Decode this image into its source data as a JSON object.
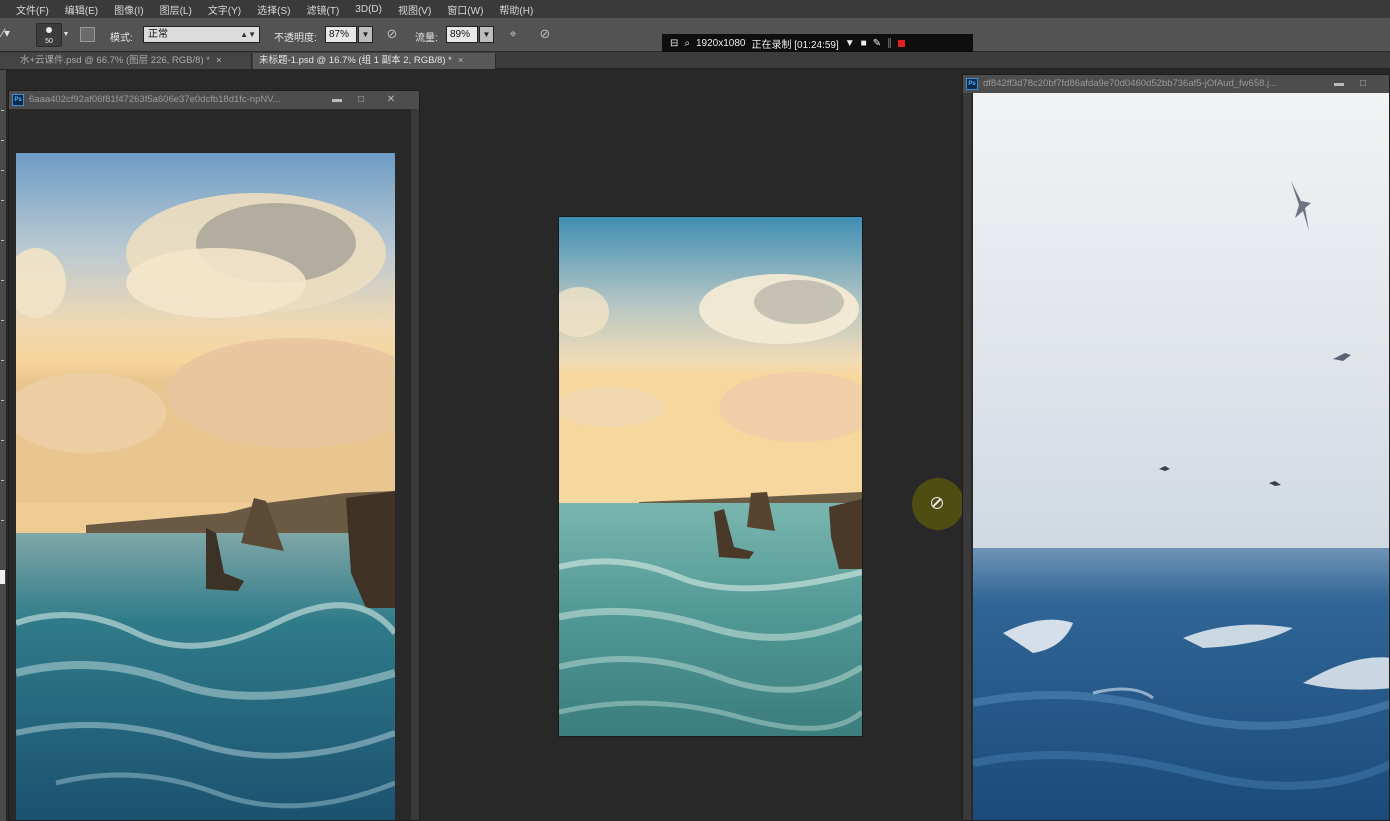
{
  "menu": [
    "文件(F)",
    "编辑(E)",
    "图像(I)",
    "图层(L)",
    "文字(Y)",
    "选择(S)",
    "滤镜(T)",
    "3D(D)",
    "视图(V)",
    "窗口(W)",
    "帮助(H)"
  ],
  "options": {
    "brush_size": "50",
    "mode_label": "模式:",
    "mode_value": "正常",
    "opacity_label": "不透明度:",
    "opacity_value": "87%",
    "flow_label": "流量:",
    "flow_value": "89%"
  },
  "recorder": {
    "resolution": "1920x1080",
    "status": "正在录制 [01:24:59]"
  },
  "tabs": [
    {
      "label": "水+云课件.psd @ 66.7% (图层 226, RGB/8) *",
      "close": "×"
    },
    {
      "label": "未标题-1.psd @ 16.7% (组 1 副本 2, RGB/8) *",
      "close": "×"
    }
  ],
  "windows": {
    "left_title": "6aaa402cf92af06f81f47263f5a606e37e0dcfb18d1fc-npNV...",
    "right_title": "df842ff3d78c20bf7fd86afda9e70d0460d52bb736af5-jOfAud_fw658.j...",
    "ps_badge": "Ps",
    "minimize": "▬",
    "maximize": "□",
    "close": "✕"
  },
  "colors": {
    "panel": "#535353",
    "menubar": "#3a3a3a",
    "workspace": "#282828",
    "record_red": "#e02020"
  }
}
